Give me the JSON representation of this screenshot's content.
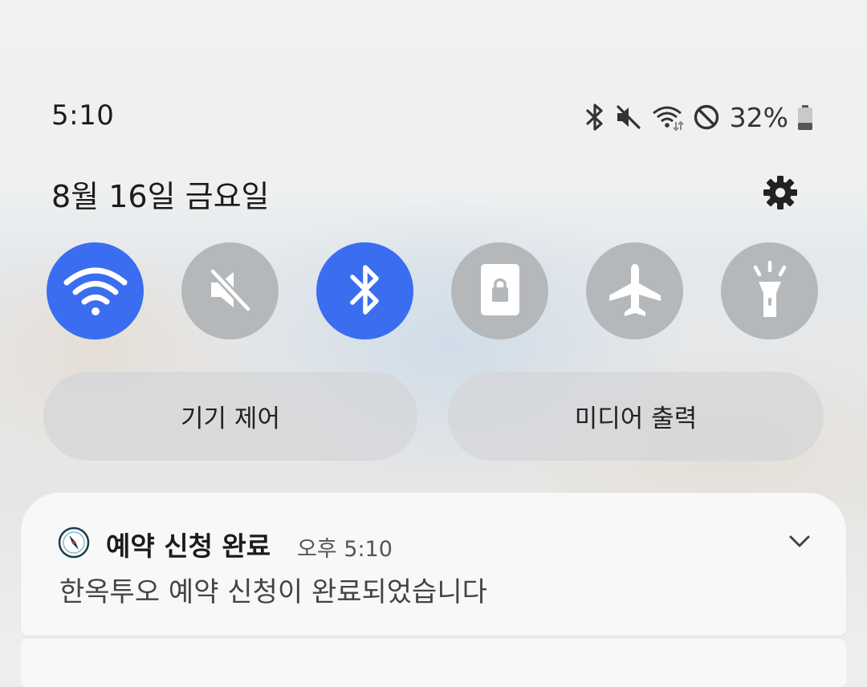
{
  "status_bar": {
    "time": "5:10",
    "battery_percent": "32%",
    "battery_level": 0.32,
    "icons": [
      "bluetooth-icon",
      "mute-icon",
      "wifi-data-icon",
      "do-not-disturb-icon",
      "battery-icon"
    ]
  },
  "header": {
    "date": "8월 16일 금요일",
    "settings_icon": "gear-icon"
  },
  "quick_toggles": [
    {
      "name": "wifi",
      "icon": "wifi-icon",
      "state": "on"
    },
    {
      "name": "sound",
      "icon": "mute-icon",
      "state": "off"
    },
    {
      "name": "bluetooth",
      "icon": "bluetooth-icon",
      "state": "on"
    },
    {
      "name": "portrait-lock",
      "icon": "rotation-lock-icon",
      "state": "off"
    },
    {
      "name": "airplane-mode",
      "icon": "airplane-icon",
      "state": "off"
    },
    {
      "name": "flashlight",
      "icon": "flashlight-icon",
      "state": "off"
    }
  ],
  "buttons": {
    "device_control": "기기 제어",
    "media_output": "미디어 출력"
  },
  "notification": {
    "title": "예약 신청 완료",
    "time": "오후 5:10",
    "body": "한옥투오 예약 신청이 완료되었습니다",
    "expand_icon": "chevron-down-icon"
  },
  "colors": {
    "toggle_on": "#3a6df0",
    "toggle_off": "#b5b8bb"
  }
}
